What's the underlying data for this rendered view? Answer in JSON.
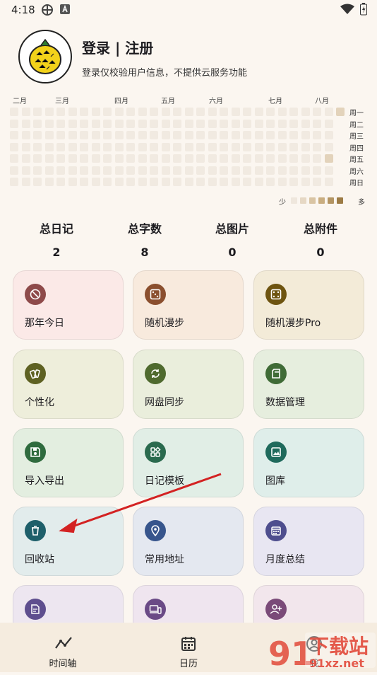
{
  "status_bar": {
    "time": "4:18"
  },
  "header": {
    "login_title": "登录 | 注册",
    "login_subtitle": "登录仅校验用户信息，不提供云服务功能"
  },
  "heatmap": {
    "months": [
      "二月",
      "三月",
      "四月",
      "五月",
      "六月",
      "七月",
      "八月"
    ],
    "weekdays": [
      "周一",
      "周二",
      "周三",
      "周四",
      "周五",
      "周六",
      "周日"
    ],
    "legend_less": "少",
    "legend_more": "多",
    "legend_colors": [
      "#EFE7DD",
      "#E6D8C4",
      "#D9C4A3",
      "#C9AD80",
      "#B39462",
      "#9C7B45"
    ],
    "active_color": "#E3D3BB"
  },
  "stats": [
    {
      "label": "总日记",
      "value": "2"
    },
    {
      "label": "总字数",
      "value": "8"
    },
    {
      "label": "总图片",
      "value": "0"
    },
    {
      "label": "总附件",
      "value": "0"
    }
  ],
  "cards": [
    {
      "label": "那年今日",
      "icon": "history-icon",
      "bg": "#FBE9E7",
      "icon_bg": "#8E4A4A"
    },
    {
      "label": "随机漫步",
      "icon": "dice-icon",
      "bg": "#F8EADD",
      "icon_bg": "#8B4F2E"
    },
    {
      "label": "随机漫步Pro",
      "icon": "dice-pro-icon",
      "bg": "#F3EBD8",
      "icon_bg": "#6E5410"
    },
    {
      "label": "个性化",
      "icon": "palette-icon",
      "bg": "#EEEEDB",
      "icon_bg": "#5E6122"
    },
    {
      "label": "网盘同步",
      "icon": "sync-icon",
      "bg": "#EAEEDC",
      "icon_bg": "#4F6A2E"
    },
    {
      "label": "数据管理",
      "icon": "sd-card-icon",
      "bg": "#E6EEDE",
      "icon_bg": "#3F6B36"
    },
    {
      "label": "导入导出",
      "icon": "save-icon",
      "bg": "#E3EEE0",
      "icon_bg": "#2F6B3E"
    },
    {
      "label": "日记模板",
      "icon": "template-icon",
      "bg": "#E1EEE6",
      "icon_bg": "#2A6A4E"
    },
    {
      "label": "图库",
      "icon": "gallery-icon",
      "bg": "#DFEEEA",
      "icon_bg": "#1F6A5C"
    },
    {
      "label": "回收站",
      "icon": "trash-icon",
      "bg": "#E2ECEC",
      "icon_bg": "#1E5F6A"
    },
    {
      "label": "常用地址",
      "icon": "location-icon",
      "bg": "#E4E8F0",
      "icon_bg": "#37558C"
    },
    {
      "label": "月度总结",
      "icon": "calendar-grid-icon",
      "bg": "#E8E6F2",
      "icon_bg": "#4E4E8E"
    },
    {
      "label": "",
      "icon": "document-icon",
      "bg": "#EDE6F0",
      "icon_bg": "#5E4E8E"
    },
    {
      "label": "",
      "icon": "devices-icon",
      "bg": "#EFE5EF",
      "icon_bg": "#6A4A86"
    },
    {
      "label": "",
      "icon": "add-user-icon",
      "bg": "#F2E6EC",
      "icon_bg": "#7A4A78"
    }
  ],
  "bottom_nav": [
    {
      "label": "时间轴",
      "icon": "timeline-icon"
    },
    {
      "label": "日历",
      "icon": "calendar-icon"
    },
    {
      "label": "我",
      "icon": "profile-icon"
    }
  ],
  "watermark": {
    "brand": "下载站",
    "domain": "91xz.net"
  },
  "annotation": {
    "arrow_color": "#D32222"
  }
}
